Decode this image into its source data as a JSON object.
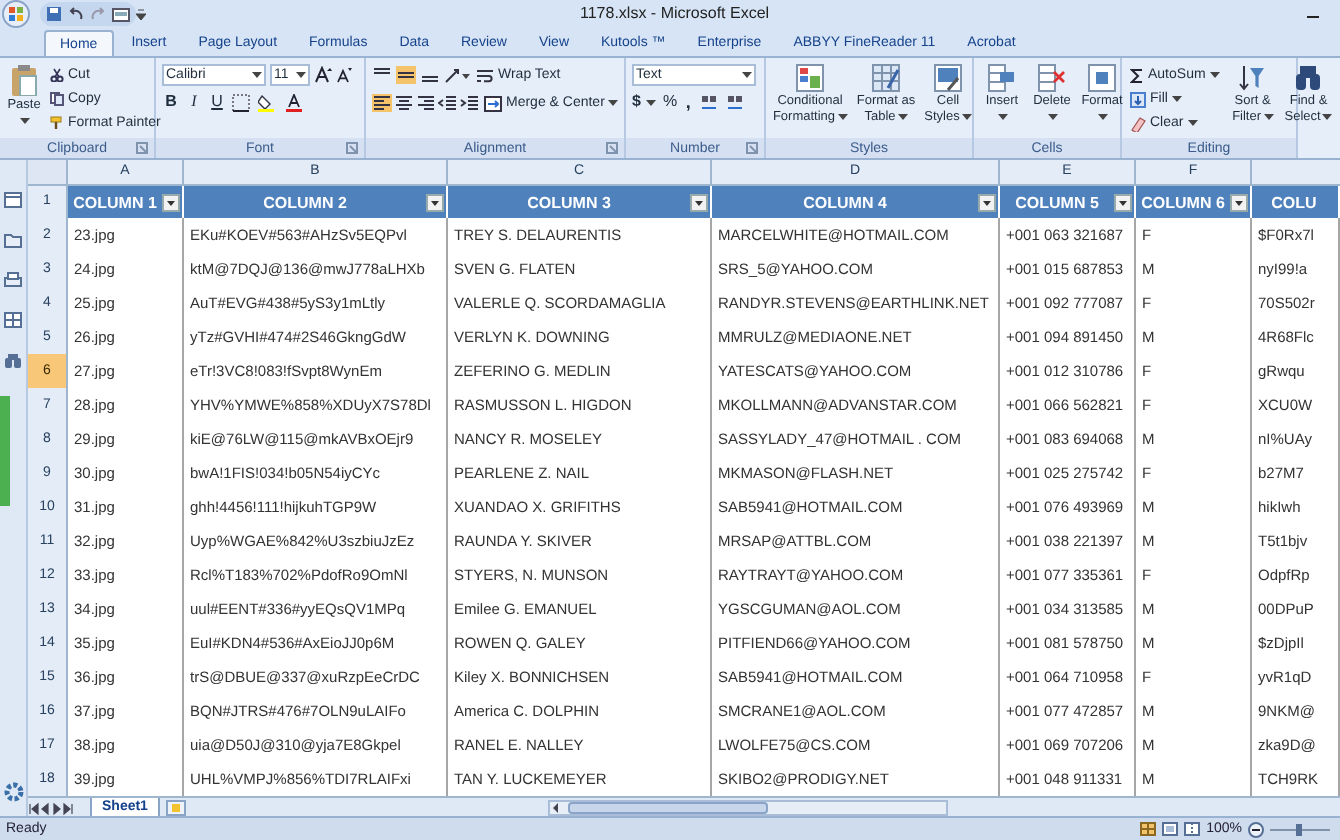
{
  "window": {
    "title": "1178.xlsx - Microsoft Excel"
  },
  "ribbon_tabs": [
    {
      "label": "Home",
      "selected": true
    },
    {
      "label": "Insert",
      "selected": false
    },
    {
      "label": "Page Layout",
      "selected": false
    },
    {
      "label": "Formulas",
      "selected": false
    },
    {
      "label": "Data",
      "selected": false
    },
    {
      "label": "Review",
      "selected": false
    },
    {
      "label": "View",
      "selected": false
    },
    {
      "label": "Kutools ™",
      "selected": false
    },
    {
      "label": "Enterprise",
      "selected": false
    },
    {
      "label": "ABBYY FineReader 11",
      "selected": false
    },
    {
      "label": "Acrobat",
      "selected": false
    }
  ],
  "clipboard": {
    "label": "Clipboard",
    "paste": "Paste",
    "cut": "Cut",
    "copy": "Copy",
    "format_painter": "Format Painter"
  },
  "font": {
    "label": "Font",
    "name": "Calibri",
    "size": "11",
    "bold": "B",
    "italic": "I",
    "underline": "U"
  },
  "alignment": {
    "label": "Alignment",
    "wrap_text": "Wrap Text",
    "merge_center": "Merge & Center"
  },
  "number": {
    "label": "Number",
    "format": "Text",
    "currency": "$",
    "percent": "%",
    "comma": ","
  },
  "styles": {
    "label": "Styles",
    "buttons": [
      "Conditional Formatting",
      "Format as Table",
      "Cell Styles"
    ]
  },
  "cells": {
    "label": "Cells",
    "buttons": [
      "Insert",
      "Delete",
      "Format"
    ]
  },
  "editing": {
    "label": "Editing",
    "autosum": "AutoSum",
    "fill": "Fill",
    "clear": "Clear",
    "buttons": [
      "Sort & Filter",
      "Find & Select"
    ]
  },
  "column_letters": [
    "A",
    "B",
    "C",
    "D",
    "E",
    "F"
  ],
  "table": {
    "header_row": "1",
    "columns": [
      {
        "label": "COLUMN 1",
        "filter_button": true
      },
      {
        "label": "COLUMN 2",
        "filter_button": true
      },
      {
        "label": "COLUMN 3",
        "filter_button": true
      },
      {
        "label": "COLUMN 4",
        "filter_button": true
      },
      {
        "label": "COLUMN 5",
        "filter_button": true
      },
      {
        "label": "COLUMN 6",
        "filter_button": true
      },
      {
        "label": "COLU",
        "filter_button": false
      }
    ],
    "rows": [
      {
        "number": "2",
        "selected": false,
        "cells": [
          "23.jpg",
          "EKu#KOEV#563#AHzSv5EQPvl",
          "TREY S. DELAURENTIS",
          "MARCELWHITE@HOTMAIL.COM",
          "+001 063 321687",
          "F",
          "$F0Rx7l"
        ]
      },
      {
        "number": "3",
        "selected": false,
        "cells": [
          "24.jpg",
          "ktM@7DQJ@136@mwJ778aLHXb",
          "SVEN G. FLATEN",
          "SRS_5@YAHOO.COM",
          "+001 015 687853",
          "M",
          "nyI99!a"
        ]
      },
      {
        "number": "4",
        "selected": false,
        "cells": [
          "25.jpg",
          "AuT#EVG#438#5yS3y1mLtly",
          "VALERLE Q. SCORDAMAGLIA",
          "RANDYR.STEVENS@EARTHLINK.NET",
          "+001 092 777087",
          "F",
          "70S502r"
        ]
      },
      {
        "number": "5",
        "selected": false,
        "cells": [
          "26.jpg",
          "yTz#GVHI#474#2S46GkngGdW",
          "VERLYN K. DOWNING",
          "MMRULZ@MEDIAONE.NET",
          "+001 094 891450",
          "M",
          "4R68Flc"
        ]
      },
      {
        "number": "6",
        "selected": true,
        "cells": [
          "27.jpg",
          "eTr!3VC8!083!fSvpt8WynEm",
          "ZEFERINO G. MEDLIN",
          "YATESCATS@YAHOO.COM",
          "+001 012 310786",
          "F",
          "gRwqu"
        ]
      },
      {
        "number": "7",
        "selected": false,
        "cells": [
          "28.jpg",
          "YHV%YMWE%858%XDUyX7S78Dl",
          "RASMUSSON L. HIGDON",
          "MKOLLMANN@ADVANSTAR.COM",
          "+001 066 562821",
          "F",
          "XCU0W"
        ]
      },
      {
        "number": "8",
        "selected": false,
        "cells": [
          "29.jpg",
          "kiE@76LW@115@mkAVBxOEjr9",
          "NANCY R. MOSELEY",
          "SASSYLADY_47@HOTMAIL . COM",
          "+001 083 694068",
          "M",
          "nI%UAy"
        ]
      },
      {
        "number": "9",
        "selected": false,
        "cells": [
          "30.jpg",
          "bwA!1FIS!034!b05N54iyCYc",
          "PEARLENE Z. NAIL",
          "MKMASON@FLASH.NET",
          "+001 025 275742",
          "F",
          "b27M7"
        ]
      },
      {
        "number": "10",
        "selected": false,
        "cells": [
          "31.jpg",
          "ghh!4456!111!hijkuhTGP9W",
          "XUANDAO X. GRIFITHS",
          "SAB5941@HOTMAIL.COM",
          "+001 076 493969",
          "M",
          "hikIwh"
        ]
      },
      {
        "number": "11",
        "selected": false,
        "cells": [
          "32.jpg",
          "Uyp%WGAE%842%U3szbiuJzEz",
          "RAUNDA Y. SKIVER",
          "MRSAP@ATTBL.COM",
          "+001 038 221397",
          "M",
          "T5t1bjv"
        ]
      },
      {
        "number": "12",
        "selected": false,
        "cells": [
          "33.jpg",
          "Rcl%T183%702%PdofRo9OmNl",
          "STYERS, N. MUNSON",
          "RAYTRAYT@YAHOO.COM",
          "+001 077 335361",
          "F",
          "OdpfRp"
        ]
      },
      {
        "number": "13",
        "selected": false,
        "cells": [
          "34.jpg",
          "uul#EENT#336#yyEQsQV1MPq",
          "Emilee G. EMANUEL",
          "YGSCGUMAN@AOL.COM",
          "+001 034 313585",
          "M",
          "00DPuP"
        ]
      },
      {
        "number": "14",
        "selected": false,
        "cells": [
          "35.jpg",
          "EuI#KDN4#536#AxEioJJ0p6M",
          "ROWEN Q. GALEY",
          "PITFIEND66@YAHOO.COM",
          "+001 081 578750",
          "M",
          "$zDjpIl"
        ]
      },
      {
        "number": "15",
        "selected": false,
        "cells": [
          "36.jpg",
          "trS@DBUE@337@xuRzpEeCrDC",
          "Kiley X. BONNICHSEN",
          "SAB5941@HOTMAIL.COM",
          "+001 064 710958",
          "F",
          "yvR1qD"
        ]
      },
      {
        "number": "16",
        "selected": false,
        "cells": [
          "37.jpg",
          "BQN#JTRS#476#7OLN9uLAIFo",
          "America C. DOLPHIN",
          "SMCRANE1@AOL.COM",
          "+001 077 472857",
          "M",
          "9NKM@"
        ]
      },
      {
        "number": "17",
        "selected": false,
        "cells": [
          "38.jpg",
          "uia@D50J@310@yja7E8Gkpel",
          "RANEL E. NALLEY",
          "LWOLFE75@CS.COM",
          "+001 069 707206",
          "M",
          "zka9D@"
        ]
      },
      {
        "number": "18",
        "selected": false,
        "cells": [
          "39.jpg",
          "UHL%VMPJ%856%TDI7RLAIFxi",
          "TAN Y. LUCKEMEYER",
          "SKIBO2@PRODIGY.NET",
          "+001 048 911331",
          "M",
          "TCH9RK"
        ]
      }
    ]
  },
  "sheet_tabs": [
    {
      "label": "Sheet1",
      "selected": true
    }
  ],
  "status_bar": {
    "text": "Ready",
    "zoom": "100%"
  }
}
